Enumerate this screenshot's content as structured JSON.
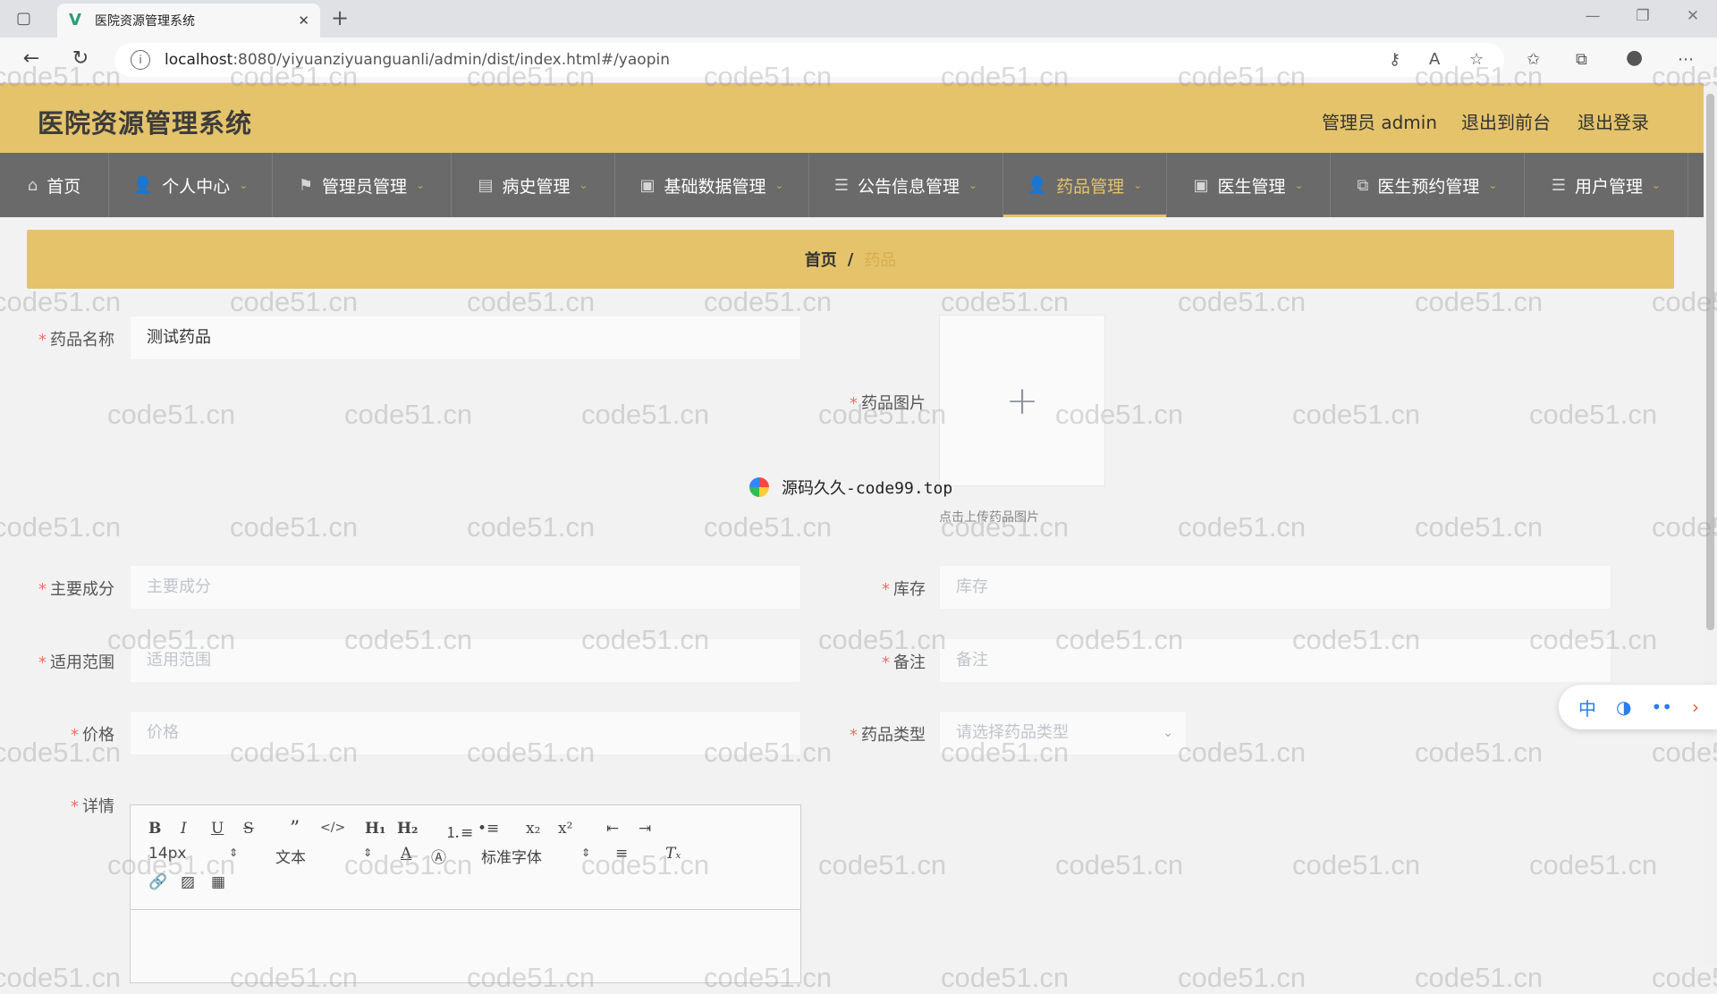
{
  "browser": {
    "tab_title": "医院资源管理系统",
    "new_tab": "+",
    "url_host": "localhost",
    "url_rest": ":8080/yiyuanziyuanguanli/admin/dist/index.html#/yaopin"
  },
  "header": {
    "title": "医院资源管理系统",
    "user": "管理员 admin",
    "to_front": "退出到前台",
    "logout": "退出登录"
  },
  "nav": {
    "items": [
      {
        "label": "首页",
        "icon": "home-icon"
      },
      {
        "label": "个人中心",
        "icon": "user-icon"
      },
      {
        "label": "管理员管理",
        "icon": "flag-icon"
      },
      {
        "label": "病史管理",
        "icon": "clipboard-icon"
      },
      {
        "label": "基础数据管理",
        "icon": "monitor-icon"
      },
      {
        "label": "公告信息管理",
        "icon": "list-icon"
      },
      {
        "label": "药品管理",
        "icon": "user-icon"
      },
      {
        "label": "医生管理",
        "icon": "monitor-icon"
      },
      {
        "label": "医生预约管理",
        "icon": "copy-icon"
      },
      {
        "label": "用户管理",
        "icon": "list-icon"
      }
    ],
    "active": "药品管理"
  },
  "breadcrumb": {
    "home": "首页",
    "sep": "/",
    "current": "药品"
  },
  "form": {
    "name_label": "药品名称",
    "name_value": "测试药品",
    "image_label": "药品图片",
    "image_hint": "点击上传药品图片",
    "ingredients_label": "主要成分",
    "ingredients_placeholder": "主要成分",
    "stock_label": "库存",
    "stock_placeholder": "库存",
    "scope_label": "适用范围",
    "scope_placeholder": "适用范围",
    "remark_label": "备注",
    "remark_placeholder": "备注",
    "price_label": "价格",
    "price_placeholder": "价格",
    "type_label": "药品类型",
    "type_placeholder": "请选择药品类型",
    "detail_label": "详情",
    "required_mark": "*"
  },
  "editor": {
    "font_size": "14px",
    "block": "文本",
    "font": "标准字体"
  },
  "overlay": {
    "source_mark": "源码久久-code99.top",
    "watermark": "code51.cn",
    "widget": [
      "中",
      "◑",
      "••",
      "›"
    ]
  },
  "colors": {
    "accent": "#e5c36a",
    "nav_bg": "#6a6a6a",
    "required": "#f56c6c"
  }
}
